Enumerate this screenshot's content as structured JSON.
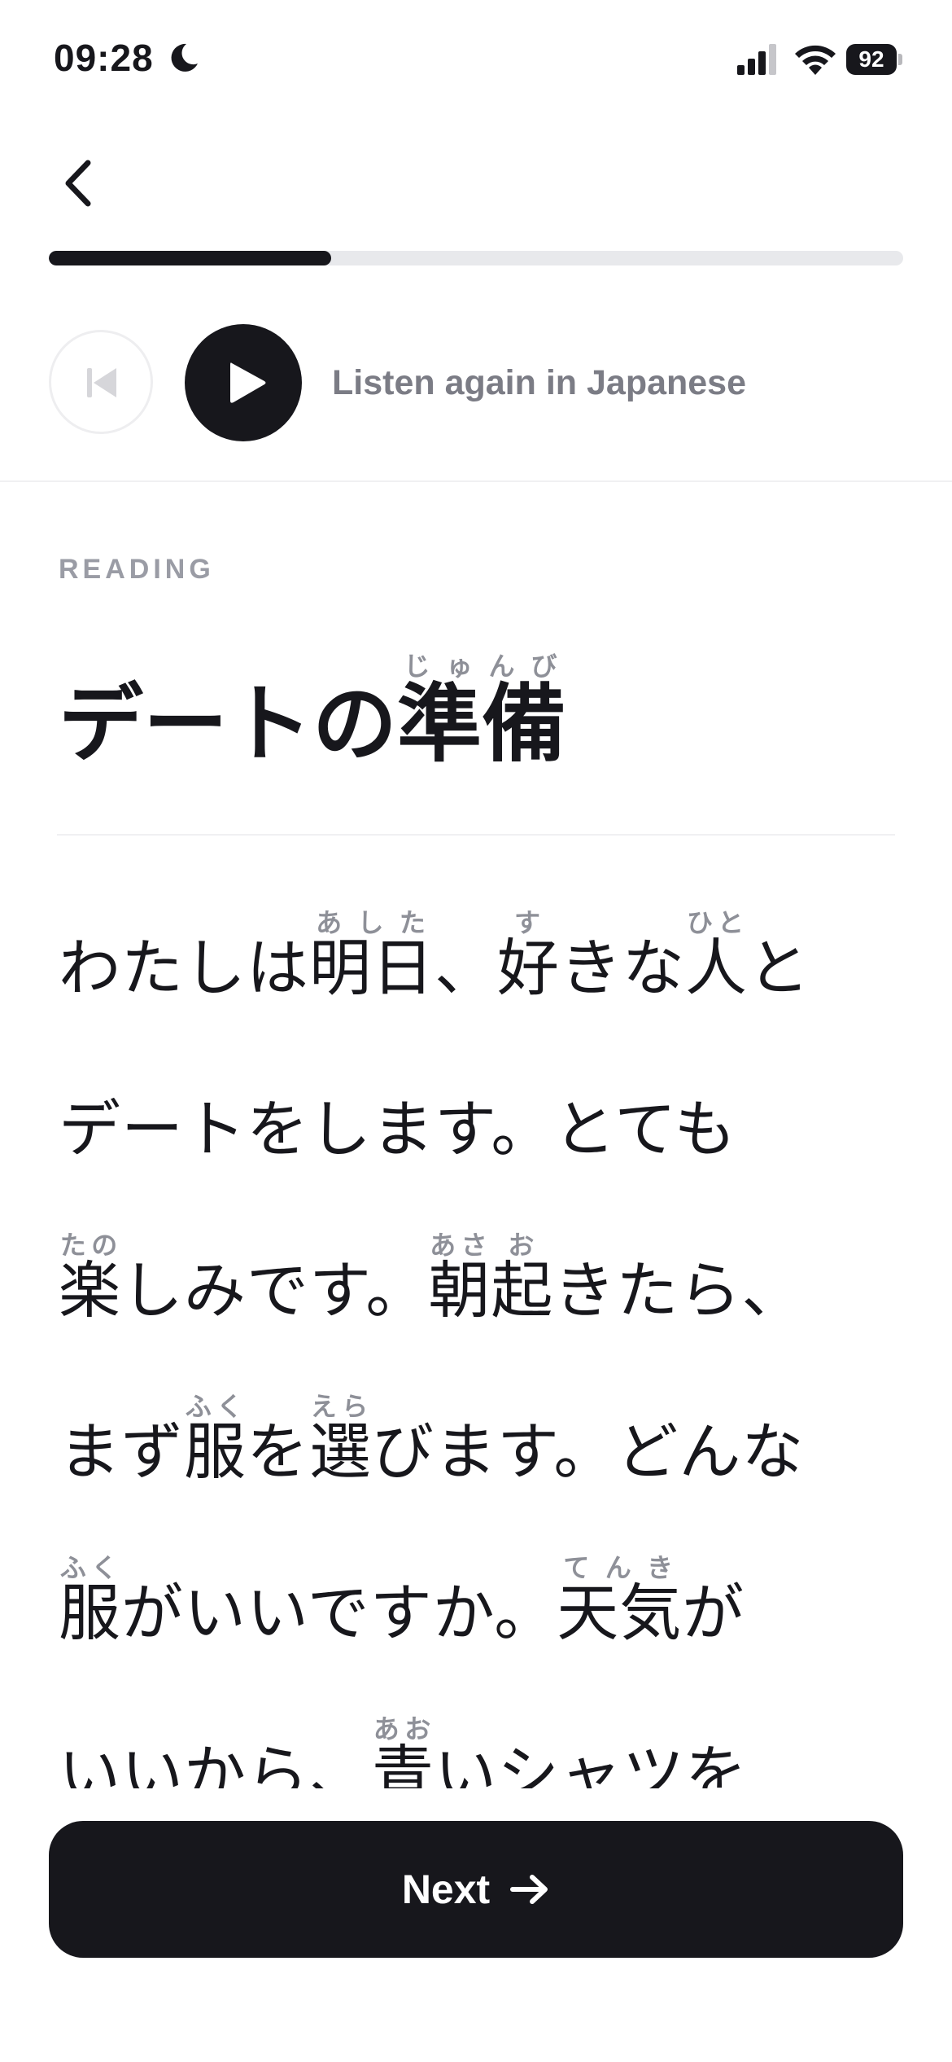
{
  "status_bar": {
    "time": "09:28",
    "battery": "92"
  },
  "progress": {
    "fraction": 0.33
  },
  "audio": {
    "listen_label": "Listen again in Japanese"
  },
  "reading": {
    "section_label": "READING",
    "title": {
      "text": "デートの",
      "kanji": "準備",
      "furigana": "じゅんび"
    },
    "lines": [
      [
        {
          "t": "わたしは"
        },
        {
          "k": "明日",
          "r": "あした"
        },
        {
          "t": "、"
        },
        {
          "k": "好",
          "r": "す"
        },
        {
          "t": "きな"
        },
        {
          "k": "人",
          "r": "ひと"
        },
        {
          "t": "と"
        }
      ],
      [
        {
          "t": "デートをします。とても"
        }
      ],
      [
        {
          "k": "楽",
          "r": "たの"
        },
        {
          "t": "しみです。"
        },
        {
          "k": "朝",
          "r": "あさ"
        },
        {
          "k": "起",
          "r": "お"
        },
        {
          "t": "きたら、"
        }
      ],
      [
        {
          "t": "まず"
        },
        {
          "k": "服",
          "r": "ふく"
        },
        {
          "t": "を"
        },
        {
          "k": "選",
          "r": "えら"
        },
        {
          "t": "びます。どんな"
        }
      ],
      [
        {
          "k": "服",
          "r": "ふく"
        },
        {
          "t": "がいいですか。"
        },
        {
          "k": "天気",
          "r": "てんき"
        },
        {
          "t": "が"
        }
      ],
      [
        {
          "t": "いいから、"
        },
        {
          "k": "青",
          "r": "あお"
        },
        {
          "t": "いシャツを"
        }
      ]
    ]
  },
  "next_button": {
    "label": "Next"
  }
}
